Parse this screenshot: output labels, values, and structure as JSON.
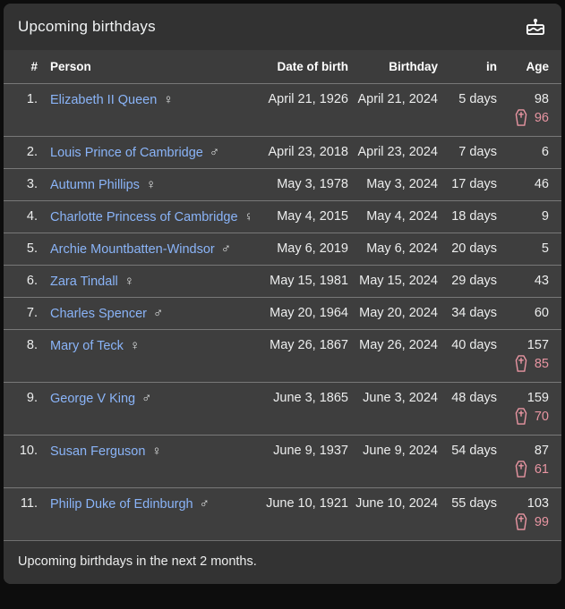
{
  "card": {
    "title": "Upcoming birthdays",
    "footer_note": "Upcoming birthdays in the next 2 months."
  },
  "icons": {
    "header": "cake-icon",
    "death": "coffin-icon"
  },
  "colors": {
    "link": "#8ab4f8",
    "death_accent": "#e895a2",
    "card_bg": "#3e3e3e",
    "outer_bg": "#0d0d0d"
  },
  "table": {
    "columns": [
      "#",
      "Person",
      "Date of birth",
      "Birthday",
      "in",
      "Age"
    ],
    "rows": [
      {
        "rank": "1.",
        "person": "Elizabeth II Queen",
        "gender": "♀",
        "dob": "April 21, 1926",
        "birthday": "April 21, 2024",
        "in": "5 days",
        "age": "98",
        "death_age": "96"
      },
      {
        "rank": "2.",
        "person": "Louis Prince of Cambridge",
        "gender": "♂",
        "dob": "April 23, 2018",
        "birthday": "April 23, 2024",
        "in": "7 days",
        "age": "6",
        "death_age": ""
      },
      {
        "rank": "3.",
        "person": "Autumn Phillips",
        "gender": "♀",
        "dob": "May 3, 1978",
        "birthday": "May 3, 2024",
        "in": "17 days",
        "age": "46",
        "death_age": ""
      },
      {
        "rank": "4.",
        "person": "Charlotte Princess of Cambridge",
        "gender": "♀",
        "dob": "May 4, 2015",
        "birthday": "May 4, 2024",
        "in": "18 days",
        "age": "9",
        "death_age": ""
      },
      {
        "rank": "5.",
        "person": "Archie Mountbatten-Windsor",
        "gender": "♂",
        "dob": "May 6, 2019",
        "birthday": "May 6, 2024",
        "in": "20 days",
        "age": "5",
        "death_age": ""
      },
      {
        "rank": "6.",
        "person": "Zara Tindall",
        "gender": "♀",
        "dob": "May 15, 1981",
        "birthday": "May 15, 2024",
        "in": "29 days",
        "age": "43",
        "death_age": ""
      },
      {
        "rank": "7.",
        "person": "Charles Spencer",
        "gender": "♂",
        "dob": "May 20, 1964",
        "birthday": "May 20, 2024",
        "in": "34 days",
        "age": "60",
        "death_age": ""
      },
      {
        "rank": "8.",
        "person": "Mary of Teck",
        "gender": "♀",
        "dob": "May 26, 1867",
        "birthday": "May 26, 2024",
        "in": "40 days",
        "age": "157",
        "death_age": "85"
      },
      {
        "rank": "9.",
        "person": "George V King",
        "gender": "♂",
        "dob": "June 3, 1865",
        "birthday": "June 3, 2024",
        "in": "48 days",
        "age": "159",
        "death_age": "70"
      },
      {
        "rank": "10.",
        "person": "Susan Ferguson",
        "gender": "♀",
        "dob": "June 9, 1937",
        "birthday": "June 9, 2024",
        "in": "54 days",
        "age": "87",
        "death_age": "61"
      },
      {
        "rank": "11.",
        "person": "Philip Duke of Edinburgh",
        "gender": "♂",
        "dob": "June 10, 1921",
        "birthday": "June 10, 2024",
        "in": "55 days",
        "age": "103",
        "death_age": "99"
      }
    ]
  }
}
